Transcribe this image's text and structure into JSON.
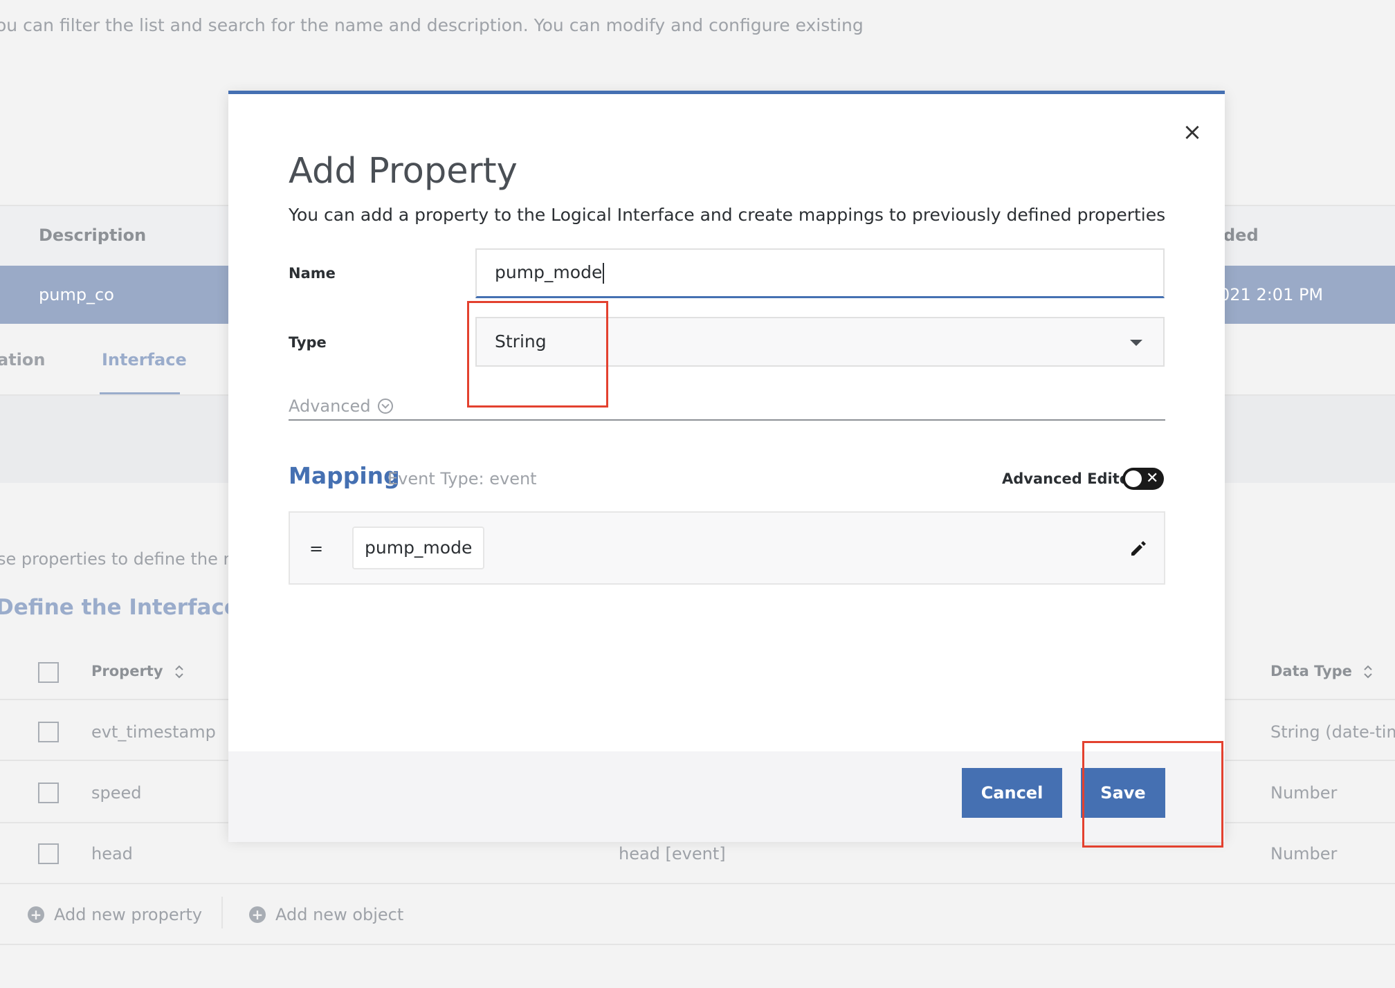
{
  "background": {
    "intro_text": "ou can filter the list and search for the name and description. You can modify and configure existing",
    "table_columns": {
      "description": "Description",
      "added": "ded"
    },
    "selected_row": {
      "name": "pump_co",
      "date": "021 2:01 PM"
    },
    "tabs": [
      "ation",
      "Interface"
    ],
    "help_text": "se properties to define the ma",
    "section_title": "Define the Interface",
    "properties_table": {
      "headers": {
        "property": "Property",
        "data_type": "Data Type"
      },
      "rows": [
        {
          "property": "evt_timestamp",
          "mapping": "",
          "data_type": "String (date-tim"
        },
        {
          "property": "speed",
          "mapping": "",
          "data_type": "Number"
        },
        {
          "property": "head",
          "mapping": "head [event]",
          "data_type": "Number"
        }
      ]
    },
    "add_property_label": "Add new property",
    "add_object_label": "Add new object"
  },
  "modal": {
    "title": "Add Property",
    "subtitle": "You can add a property to the Logical Interface and create mappings to previously defined properties",
    "name_label": "Name",
    "name_value": "pump_mode",
    "type_label": "Type",
    "type_value": "String",
    "advanced_label": "Advanced",
    "mapping_title": "Mapping",
    "event_type": "Event Type: event",
    "advanced_editor_label": "Advanced Editor",
    "mapping_equals": "=",
    "mapping_value": "pump_mode",
    "cancel_label": "Cancel",
    "save_label": "Save",
    "close_icon": "×"
  },
  "colors": {
    "accent": "#4570b2",
    "annotation": "#e3412f"
  }
}
